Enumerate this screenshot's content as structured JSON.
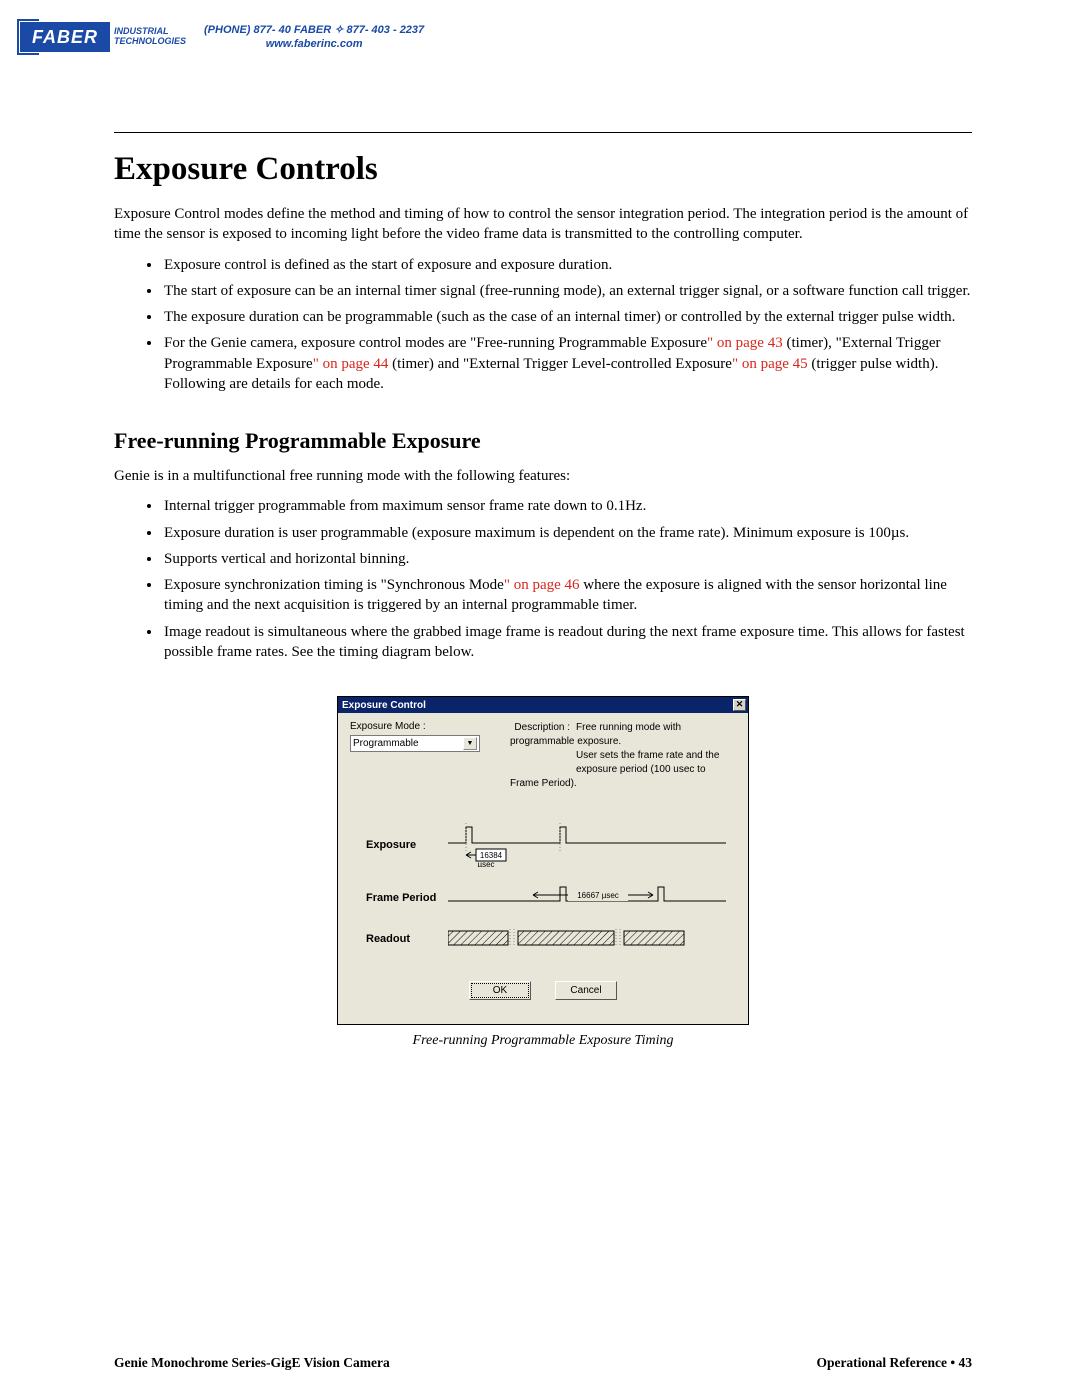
{
  "header": {
    "logo_name": "FABER",
    "logo_sub1": "INDUSTRIAL",
    "logo_sub2": "TECHNOLOGIES",
    "phone_line": "(PHONE) 877- 40 FABER  ✧  877- 403 - 2237",
    "website": "www.faberinc.com"
  },
  "title": "Exposure Controls",
  "intro": "Exposure Control modes define the method and timing of how to control the sensor integration period. The integration period is the amount of time the sensor is exposed to incoming light before the video frame data is transmitted to the controlling computer.",
  "bullets1": [
    "Exposure control is defined as the start of exposure and exposure duration.",
    "The start of exposure can be an internal timer signal (free-running mode), an external trigger signal, or a software function call trigger.",
    "The exposure duration can be programmable (such as the case of an internal timer) or controlled by the external trigger pulse width."
  ],
  "bullet1_d": {
    "pre": "For the Genie camera, exposure control modes are \"Free-running Programmable Exposure",
    "r1": "\" on page 43",
    "mid1": " (timer), \"External Trigger Programmable Exposure",
    "r2": "\" on page 44",
    "mid2": " (timer) and \"External Trigger Level-controlled Exposure",
    "r3": "\" on page 45",
    "post": " (trigger pulse width). Following are details for each mode."
  },
  "subtitle": "Free-running Programmable Exposure",
  "sublead": "Genie is in a multifunctional free running mode with the following features:",
  "bullets2": [
    "Internal trigger programmable from maximum sensor frame rate down to 0.1Hz.",
    "Exposure duration is user programmable (exposure maximum is dependent on the frame rate). Minimum exposure is 100µs.",
    "Supports vertical and horizontal binning."
  ],
  "bullet2_d": {
    "pre": "Exposure synchronization timing is \"Synchronous Mode",
    "r": "\" on page 46",
    "post": " where the exposure is aligned with the sensor horizontal line timing and the next acquisition is triggered by an internal programmable timer."
  },
  "bullet2_e": "Image readout is simultaneous where the grabbed image frame is readout during the next frame exposure time. This allows for fastest possible frame rates. See the timing diagram below.",
  "dialog": {
    "title": "Exposure Control",
    "mode_label": "Exposure Mode :",
    "mode_value": "Programmable",
    "desc_label": "Description :",
    "desc1": "Free running mode with programmable exposure.",
    "desc2": "User sets the frame rate and the",
    "desc3": "exposure period (100 usec to Frame Period).",
    "row_exposure": "Exposure",
    "row_frame": "Frame Period",
    "row_readout": "Readout",
    "exposure_val": "16384",
    "exposure_unit": "µsec",
    "frame_val": "16667  µsec",
    "ok": "OK",
    "cancel": "Cancel"
  },
  "caption": "Free-running Programmable Exposure Timing",
  "footer": {
    "left": "Genie Monochrome Series-GigE Vision Camera",
    "right": "Operational Reference  •  43"
  }
}
